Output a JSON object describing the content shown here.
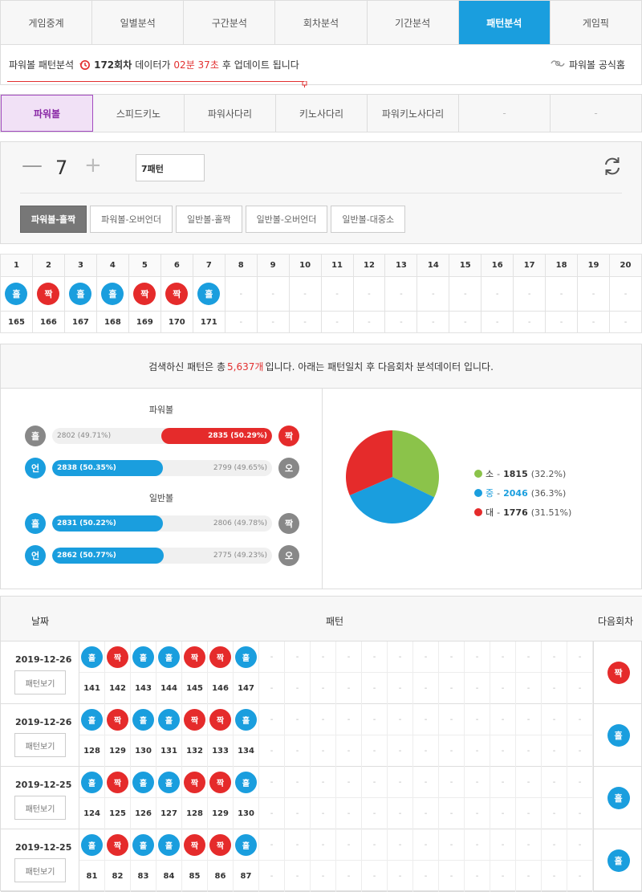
{
  "top_tabs": [
    {
      "label": "게임중계",
      "active": false
    },
    {
      "label": "일별분석",
      "active": false
    },
    {
      "label": "구간분석",
      "active": false
    },
    {
      "label": "회차분석",
      "active": false
    },
    {
      "label": "기간분석",
      "active": false
    },
    {
      "label": "패턴분석",
      "active": true
    },
    {
      "label": "게임픽",
      "active": false
    }
  ],
  "info": {
    "prefix": "파워볼 패턴분석",
    "round": "172회차",
    "mid": "데이터가",
    "countdown": "02분 37초",
    "suffix": "후 업데이트 됩니다",
    "official": "파워볼 공식홈"
  },
  "sub_tabs": [
    {
      "label": "파워볼",
      "active": true
    },
    {
      "label": "스피드키노",
      "active": false
    },
    {
      "label": "파워사다리",
      "active": false
    },
    {
      "label": "키노사다리",
      "active": false
    },
    {
      "label": "파워키노사다리",
      "active": false
    },
    {
      "label": "-",
      "active": false
    },
    {
      "label": "-",
      "active": false
    }
  ],
  "controls": {
    "minus": "—",
    "count": "7",
    "plus": "+",
    "pattern_value": "7패턴",
    "buttons": [
      {
        "label": "파워볼-홀짝",
        "active": true
      },
      {
        "label": "파워볼-오버언더",
        "active": false
      },
      {
        "label": "일반볼-홀짝",
        "active": false
      },
      {
        "label": "일반볼-오버언더",
        "active": false
      },
      {
        "label": "일반볼-대중소",
        "active": false
      }
    ]
  },
  "pattern_table": {
    "headers": [
      "1",
      "2",
      "3",
      "4",
      "5",
      "6",
      "7",
      "8",
      "9",
      "10",
      "11",
      "12",
      "13",
      "14",
      "15",
      "16",
      "17",
      "18",
      "19",
      "20"
    ],
    "balls": [
      "홀",
      "짝",
      "홀",
      "홀",
      "짝",
      "짝",
      "홀",
      "-",
      "-",
      "-",
      "-",
      "-",
      "-",
      "-",
      "-",
      "-",
      "-",
      "-",
      "-",
      "-"
    ],
    "rounds": [
      "165",
      "166",
      "167",
      "168",
      "169",
      "170",
      "171",
      "-",
      "-",
      "-",
      "-",
      "-",
      "-",
      "-",
      "-",
      "-",
      "-",
      "-",
      "-",
      "-"
    ]
  },
  "summary": {
    "before": "검색하신 패턴은 총",
    "count": "5,637개",
    "after": "입니다. 아래는 패턴일치 후 다음회차 분석데이터 입니다."
  },
  "stats": {
    "powerball_title": "파워볼",
    "normal_title": "일반볼",
    "rows": [
      {
        "left_label": "홀",
        "left_color": "gray",
        "left_text": "2802 (49.71%)",
        "left_pct": 49.71,
        "right_label": "짝",
        "right_color": "even",
        "right_text": "2835 (50.29%)",
        "right_pct": 50.29,
        "winner": "right"
      },
      {
        "left_label": "언",
        "left_color": "odd",
        "left_text": "2838 (50.35%)",
        "left_pct": 50.35,
        "right_label": "오",
        "right_color": "gray",
        "right_text": "2799 (49.65%)",
        "right_pct": 49.65,
        "winner": "left"
      },
      {
        "left_label": "홀",
        "left_color": "odd",
        "left_text": "2831 (50.22%)",
        "left_pct": 50.22,
        "right_label": "짝",
        "right_color": "gray",
        "right_text": "2806 (49.78%)",
        "right_pct": 49.78,
        "winner": "left"
      },
      {
        "left_label": "언",
        "left_color": "odd",
        "left_text": "2862 (50.77%)",
        "left_pct": 50.77,
        "right_label": "오",
        "right_color": "gray",
        "right_text": "2775 (49.23%)",
        "right_pct": 49.23,
        "winner": "left"
      }
    ],
    "pie": [
      {
        "label": "소",
        "value": 1815,
        "pct": "(32.2%)",
        "color": "#8bc34a"
      },
      {
        "label": "중",
        "value": 2046,
        "pct": "(36.3%)",
        "color": "#1a9ede"
      },
      {
        "label": "대",
        "value": 1776,
        "pct": "(31.51%)",
        "color": "#e52b2b"
      }
    ]
  },
  "history": {
    "col_date": "날짜",
    "col_pattern": "패턴",
    "col_next": "다음회차",
    "view_label": "패턴보기",
    "rows": [
      {
        "date": "2019-12-26",
        "balls": [
          "홀",
          "짝",
          "홀",
          "홀",
          "짝",
          "짝",
          "홀"
        ],
        "rounds": [
          "141",
          "142",
          "143",
          "144",
          "145",
          "146",
          "147"
        ],
        "next": "짝"
      },
      {
        "date": "2019-12-26",
        "balls": [
          "홀",
          "짝",
          "홀",
          "홀",
          "짝",
          "짝",
          "홀"
        ],
        "rounds": [
          "128",
          "129",
          "130",
          "131",
          "132",
          "133",
          "134"
        ],
        "next": "홀"
      },
      {
        "date": "2019-12-25",
        "balls": [
          "홀",
          "짝",
          "홀",
          "홀",
          "짝",
          "짝",
          "홀"
        ],
        "rounds": [
          "124",
          "125",
          "126",
          "127",
          "128",
          "129",
          "130"
        ],
        "next": "홀"
      },
      {
        "date": "2019-12-25",
        "balls": [
          "홀",
          "짝",
          "홀",
          "홀",
          "짝",
          "짝",
          "홀"
        ],
        "rounds": [
          "81",
          "82",
          "83",
          "84",
          "85",
          "86",
          "87"
        ],
        "next": "홀"
      }
    ]
  }
}
